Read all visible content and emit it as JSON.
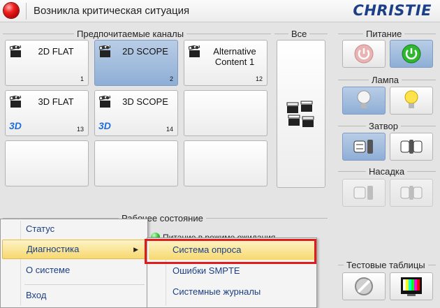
{
  "window": {
    "title": "Возникла критическая ситуация",
    "logo": "CHRISTIE"
  },
  "sections": {
    "channels": "Предпочитаемые каналы",
    "all": "Все",
    "power": "Питание",
    "lamp": "Лампа",
    "shutter": "Затвор",
    "lens": "Насадка",
    "operating_state": "Рабочее состояние",
    "test_patterns": "Тестовые таблицы"
  },
  "channels": [
    {
      "name": "2D FLAT",
      "number": "1",
      "selected": false,
      "is3d": false
    },
    {
      "name": "2D SCOPE",
      "number": "2",
      "selected": true,
      "is3d": false
    },
    {
      "name": "Alternative Content 1",
      "number": "12",
      "selected": false,
      "is3d": false
    },
    {
      "name": "3D FLAT",
      "number": "13",
      "selected": false,
      "is3d": true,
      "badge": "3D"
    },
    {
      "name": "3D SCOPE",
      "number": "14",
      "selected": false,
      "is3d": true,
      "badge": "3D"
    }
  ],
  "status": {
    "text": "Питание в режиме ожидания"
  },
  "context_menu": {
    "items": [
      {
        "label": "Статус"
      },
      {
        "label": "Диагностика",
        "highlighted": true,
        "has_submenu": true
      },
      {
        "label": "О системе"
      },
      {
        "label": "Вход"
      }
    ]
  },
  "submenu": {
    "items": [
      {
        "label": "Система опроса",
        "highlighted": true
      },
      {
        "label": "Ошибки SMPTE"
      },
      {
        "label": "Системные журналы"
      }
    ]
  },
  "colors": {
    "accent_selected": "#8eaed6",
    "menu_highlight": "#f7d970",
    "annotation": "#e01b1b",
    "logo": "#1c3f86"
  }
}
